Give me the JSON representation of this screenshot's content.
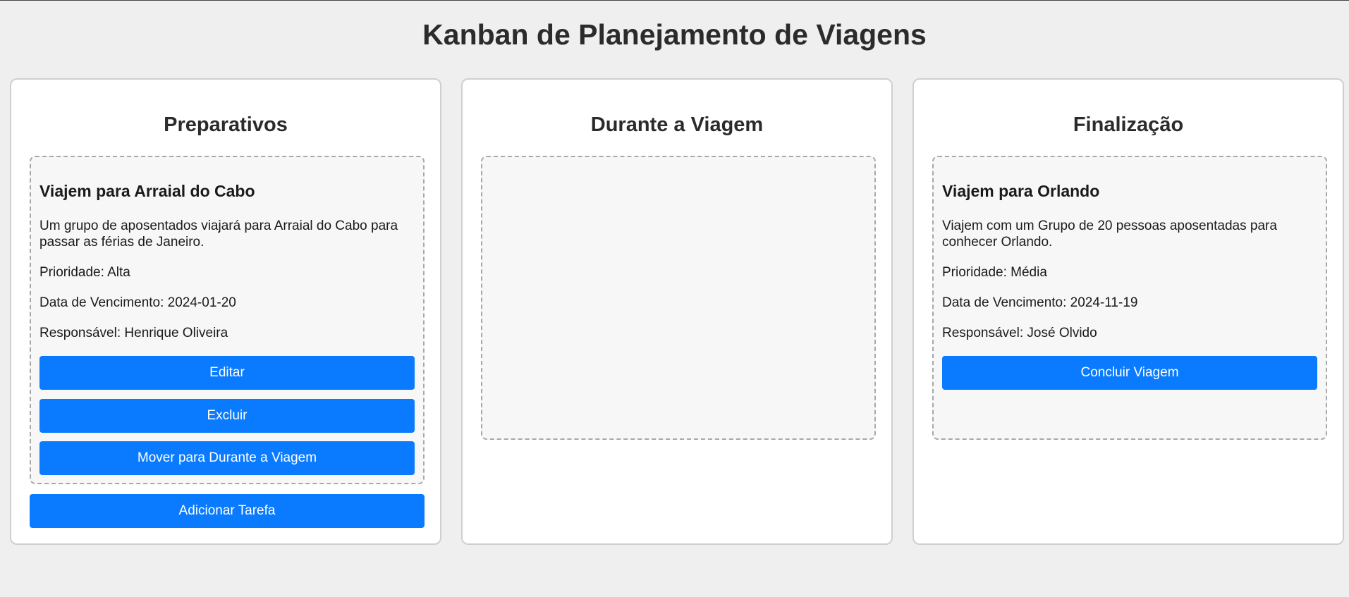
{
  "page": {
    "title": "Kanban de Planejamento de Viagens"
  },
  "columns": [
    {
      "title": "Preparativos",
      "cards": [
        {
          "title": "Viajem para Arraial do Cabo",
          "description": "Um grupo de aposentados viajará para Arraial do Cabo para passar as férias de Janeiro.",
          "priority": "Prioridade: Alta",
          "due_date": "Data de Vencimento: 2024-01-20",
          "owner": "Responsável: Henrique Oliveira",
          "buttons": [
            "Editar",
            "Excluir",
            "Mover para Durante a Viagem"
          ]
        }
      ],
      "add_button": "Adicionar Tarefa"
    },
    {
      "title": "Durante a Viagem",
      "cards": []
    },
    {
      "title": "Finalização",
      "cards": [
        {
          "title": "Viajem para Orlando",
          "description": "Viajem com um Grupo de 20 pessoas aposentadas para conhecer Orlando.",
          "priority": "Prioridade: Média",
          "due_date": "Data de Vencimento: 2024-11-19",
          "owner": "Responsável: José Olvido",
          "buttons": [
            "Concluir Viagem"
          ]
        }
      ]
    }
  ],
  "colors": {
    "background": "#efefef",
    "column_background": "#ffffff",
    "dropzone_background": "#f7f7f7",
    "button": "#0a7bff",
    "button_text": "#ffffff"
  }
}
